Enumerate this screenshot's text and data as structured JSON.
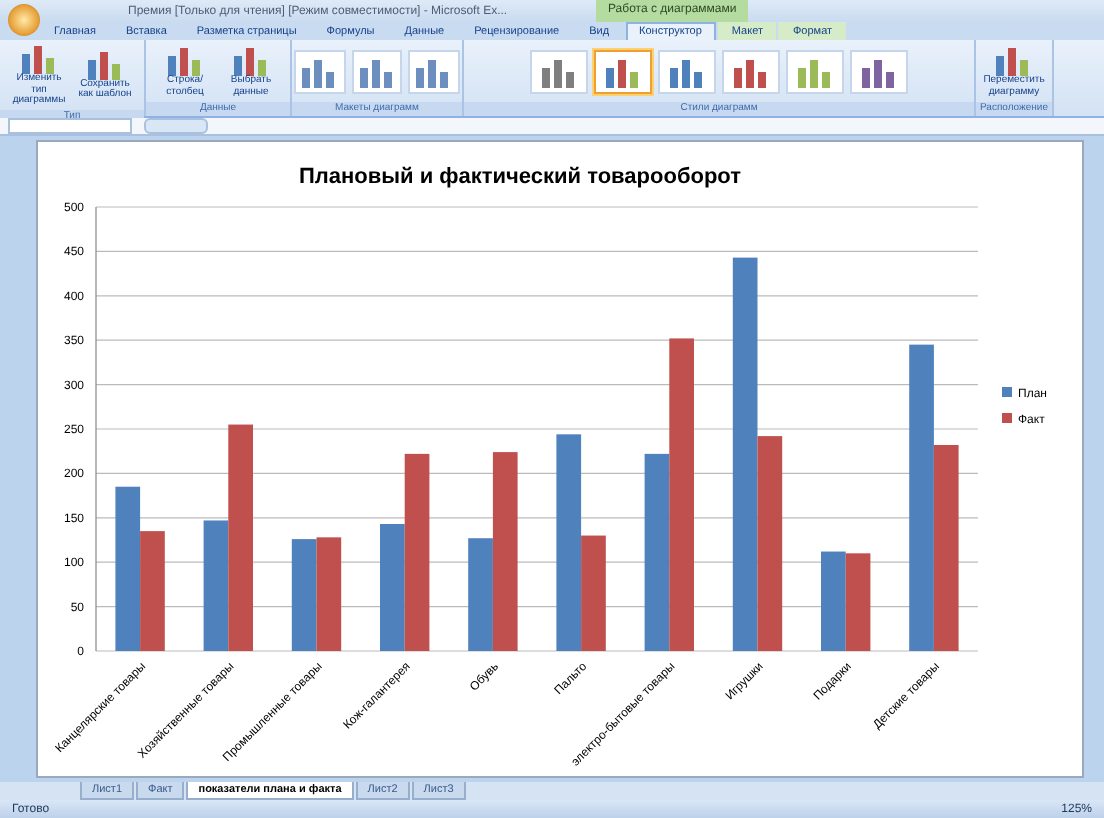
{
  "window": {
    "title": "Премия  [Только для чтения]  [Режим совместимости] - Microsoft Ex...",
    "context_label": "Работа с диаграммами"
  },
  "tabs": [
    {
      "label": "Главная",
      "selected": false,
      "context": false
    },
    {
      "label": "Вставка",
      "selected": false,
      "context": false
    },
    {
      "label": "Разметка страницы",
      "selected": false,
      "context": false
    },
    {
      "label": "Формулы",
      "selected": false,
      "context": false
    },
    {
      "label": "Данные",
      "selected": false,
      "context": false
    },
    {
      "label": "Рецензирование",
      "selected": false,
      "context": false
    },
    {
      "label": "Вид",
      "selected": false,
      "context": false
    },
    {
      "label": "Конструктор",
      "selected": true,
      "context": true
    },
    {
      "label": "Макет",
      "selected": false,
      "context": true
    },
    {
      "label": "Формат",
      "selected": false,
      "context": true
    }
  ],
  "ribbon": [
    {
      "label": "Тип",
      "kind": "buttons",
      "buttons": [
        "Изменить тип диаграммы",
        "Сохранить как шаблон"
      ]
    },
    {
      "label": "Данные",
      "kind": "buttons",
      "buttons": [
        "Строка/столбец",
        "Выбрать данные"
      ]
    },
    {
      "label": "Макеты диаграмм",
      "kind": "layouts",
      "layouts": [
        {
          "selected": false
        },
        {
          "selected": false
        },
        {
          "selected": false
        }
      ]
    },
    {
      "label": "Стили диаграмм",
      "kind": "styles",
      "styles": [
        {
          "color": "#7f7f7f",
          "selected": false
        },
        {
          "color": "#4f81bd",
          "selected": true
        },
        {
          "color": "#4f81bd",
          "selected": false
        },
        {
          "color": "#c0504d",
          "selected": false
        },
        {
          "color": "#9bbb59",
          "selected": false
        },
        {
          "color": "#8064a2",
          "selected": false
        }
      ]
    },
    {
      "label": "Расположение",
      "kind": "buttons",
      "buttons": [
        "Переместить диаграмму"
      ]
    }
  ],
  "chart": {
    "chart_data": {
      "type": "bar",
      "title": "Плановый и фактический товарооборот",
      "categories": [
        "Канцелярские товары",
        "Хозяйственные товары",
        "Промышленные товары",
        "Кож-галантерея",
        "Обувь",
        "Пальто",
        "электро-бытовые товары",
        "Игрушки",
        "Подарки",
        "Детские товары"
      ],
      "series": [
        {
          "name": "План",
          "color": "#4f81bd",
          "values": [
            185,
            147,
            126,
            143,
            127,
            244,
            222,
            443,
            112,
            345
          ]
        },
        {
          "name": "Факт",
          "color": "#c0504d",
          "values": [
            135,
            255,
            128,
            222,
            224,
            130,
            352,
            242,
            110,
            232
          ]
        }
      ],
      "ylim": [
        0,
        500
      ],
      "grid": true,
      "legend": true,
      "yticks": [
        0,
        50,
        100,
        150,
        200,
        250,
        300,
        350,
        400,
        450,
        500
      ]
    }
  },
  "sheets": [
    {
      "label": "Лист1",
      "selected": false
    },
    {
      "label": "Факт",
      "selected": false
    },
    {
      "label": "показатели плана и факта",
      "selected": true
    },
    {
      "label": "Лист2",
      "selected": false
    },
    {
      "label": "Лист3",
      "selected": false
    }
  ],
  "status": {
    "text": "Готово",
    "zoom": "125%"
  }
}
